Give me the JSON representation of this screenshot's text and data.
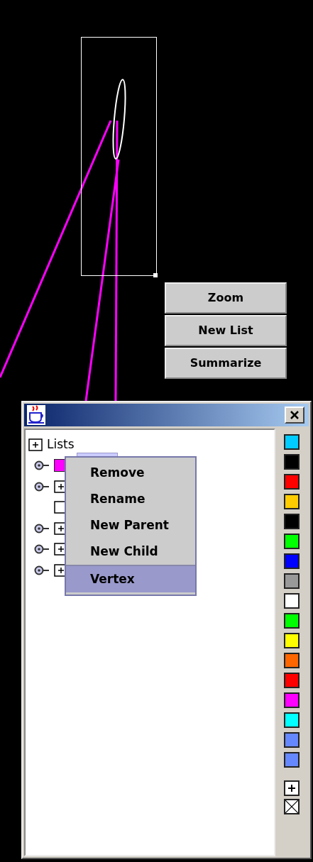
{
  "canvas_buttons": [
    "Zoom",
    "New List",
    "Summarize"
  ],
  "window": {
    "tree": {
      "root": {
        "label": "Lists",
        "expanded": false
      },
      "items": [
        {
          "kind": "color",
          "visible": true,
          "color": "#ff00ff",
          "selected": true
        },
        {
          "kind": "group",
          "visible": true,
          "selected": false
        },
        {
          "kind": "blank",
          "visible": false,
          "selected": false
        },
        {
          "kind": "group",
          "visible": true,
          "selected": false
        },
        {
          "kind": "group",
          "visible": true,
          "selected": false
        },
        {
          "kind": "group",
          "visible": true,
          "selected": false
        }
      ]
    },
    "palette": [
      {
        "color": "#00ccff"
      },
      {
        "color": "#000000"
      },
      {
        "color": "#ff0000"
      },
      {
        "color": "#ffcc00"
      },
      {
        "color": "#000000"
      },
      {
        "color": "#00ff00"
      },
      {
        "color": "#0000ff"
      },
      {
        "color": "#999999"
      },
      {
        "color": "#ffffff"
      },
      {
        "color": "#00ff00"
      },
      {
        "color": "#ffff00"
      },
      {
        "color": "#ff6600"
      },
      {
        "color": "#ff0000"
      },
      {
        "color": "#ff00ff"
      },
      {
        "color": "#00ffff"
      },
      {
        "color": "#6688ff"
      },
      {
        "color": "#6688ff"
      }
    ]
  },
  "context_menu": [
    {
      "label": "Remove",
      "selected": false
    },
    {
      "label": "Rename",
      "selected": false
    },
    {
      "label": "New Parent",
      "selected": false
    },
    {
      "label": "New Child",
      "selected": false
    },
    {
      "label": "Vertex",
      "selected": true,
      "separator_before": true
    }
  ]
}
